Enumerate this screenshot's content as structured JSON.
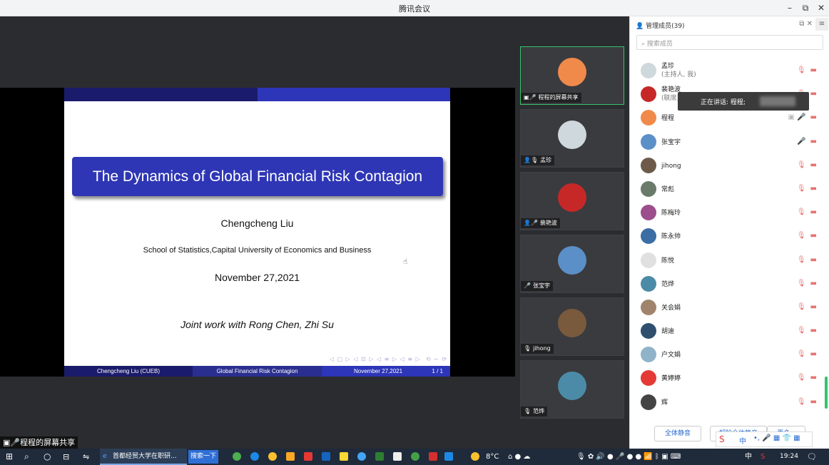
{
  "window": {
    "title": "腾讯会议"
  },
  "slide": {
    "title": "The Dynamics of Global Financial Risk Contagion",
    "author": "Chengcheng Liu",
    "school": "School of Statistics,Capital University of Economics and Business",
    "date": "November 27,2021",
    "joint": "Joint work with Rong Chen, Zhi Su",
    "footer_author": "Chengcheng Liu  (CUEB)",
    "footer_title": "Global Financial Risk Contagion",
    "footer_date": "November 27,2021",
    "footer_page": "1 / 1"
  },
  "share_label": "程程的屏幕共享",
  "video_tiles": [
    {
      "label": "程程的屏幕共享",
      "color": "#f08a4b"
    },
    {
      "label": "孟珍",
      "color": "#cfd8dc"
    },
    {
      "label": "裴艳波",
      "color": "#c62828"
    },
    {
      "label": "张宝宇",
      "color": "#5b8fc7"
    },
    {
      "label": "jihong",
      "color": "#7a5a3c"
    },
    {
      "label": "范烨",
      "color": "#4b8ba8"
    }
  ],
  "panel": {
    "title": "管理成员(39)",
    "search_placeholder": "搜索成员",
    "members": [
      {
        "name": "孟珍",
        "sub": "(主持人, 我)",
        "color": "#cfd8dc"
      },
      {
        "name": "裴艳波",
        "sub": "(联席主持人)",
        "color": "#c62828"
      },
      {
        "name": "程程",
        "sub": "",
        "color": "#f08a4b"
      },
      {
        "name": "张宝宇",
        "sub": "",
        "color": "#5b8fc7"
      },
      {
        "name": "jihong",
        "sub": "",
        "color": "#6d5a4a"
      },
      {
        "name": "常彪",
        "sub": "",
        "color": "#6a7a6b"
      },
      {
        "name": "陈梅玲",
        "sub": "",
        "color": "#9c4f8c"
      },
      {
        "name": "陈永帅",
        "sub": "",
        "color": "#3a6ea5"
      },
      {
        "name": "陈悦",
        "sub": "",
        "color": "#e0e0e0"
      },
      {
        "name": "范烨",
        "sub": "",
        "color": "#4b8ba8"
      },
      {
        "name": "关会娟",
        "sub": "",
        "color": "#a0856c"
      },
      {
        "name": "胡迪",
        "sub": "",
        "color": "#2f4f6f"
      },
      {
        "name": "户文娟",
        "sub": "",
        "color": "#8fb3c9"
      },
      {
        "name": "黄婷婷",
        "sub": "",
        "color": "#e53935"
      },
      {
        "name": "辉",
        "sub": "",
        "color": "#444444"
      }
    ],
    "speaking": "正在讲话: 程程;",
    "mute_all": "全体静音",
    "unmute_all": "解除全体静音",
    "more": "更多 ▾"
  },
  "taskbar": {
    "ie_title": "首都经贸大学在职研...",
    "search_label": "搜索一下",
    "weather": "8°C",
    "ime_lang": "中",
    "time": "19:24"
  }
}
